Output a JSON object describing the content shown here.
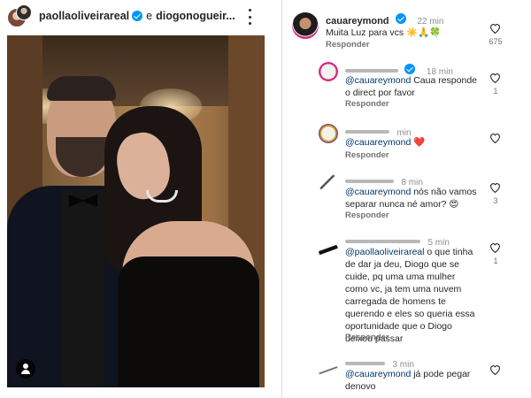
{
  "post": {
    "author1": "paollaoliveirareal",
    "connector": "e",
    "author2": "diogonogueir..."
  },
  "comments": [
    {
      "username": "cauareymond",
      "time": "22 min",
      "mention": "",
      "text": "Muita Luz para vcs ☀️🙏🍀",
      "reply": "Responder",
      "likes": "675"
    },
    {
      "username": "",
      "time": "18 min",
      "mention": "@cauareymond",
      "text": " Caua responde o direct por favor",
      "reply": "Responder",
      "likes": "1"
    },
    {
      "username": "",
      "time": "min",
      "mention": "@cauareymond",
      "text": " ❤️",
      "reply": "Responder",
      "likes": ""
    },
    {
      "username": "",
      "time": "8 min",
      "mention": "@cauareymond",
      "text": " nós não vamos separar nunca né amor? 😍",
      "reply": "Responder",
      "likes": "3"
    },
    {
      "username": "",
      "time": "5 min",
      "mention": "@paollaoliveirareal",
      "text": " o que tinha de dar ja deu, Diogo que se cuide, pq uma uma mulher como vc, ja tem uma nuvem carregada de homens te querendo e eles so queria essa oportunidade que o Diogo deixou passar",
      "reply": "Responder",
      "likes": "1"
    },
    {
      "username": "",
      "time": "3 min",
      "mention": "@cauareymond",
      "text": " já pode pegar denovo",
      "reply": "",
      "likes": ""
    }
  ],
  "colors": {
    "verified": "#0095f6",
    "mention": "#00376b",
    "heart_red": "#ed4956",
    "secondary": "#737373"
  },
  "icons": [
    "verified-badge-icon",
    "more-options-icon",
    "heart-icon",
    "user-tag-icon"
  ]
}
